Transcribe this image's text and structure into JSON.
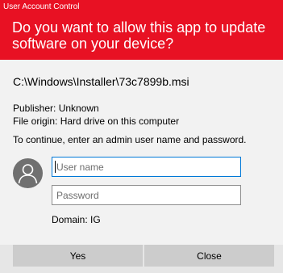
{
  "window": {
    "title": "User Account Control",
    "question": "Do you want to allow this app to update software on your device?",
    "header_color": "#e81123"
  },
  "program": {
    "path": "C:\\Windows\\Installer\\73c7899b.msi",
    "publisher": "Publisher: Unknown",
    "origin": "File origin: Hard drive on this computer"
  },
  "credentials": {
    "instruction": "To continue, enter an admin user name and password.",
    "avatar_icon": "user-avatar-icon",
    "username_placeholder": "User name",
    "username_value": "",
    "password_placeholder": "Password",
    "password_value": "",
    "domain": "Domain: IG",
    "focus_color": "#0078d7"
  },
  "buttons": {
    "yes": "Yes",
    "close": "Close"
  }
}
